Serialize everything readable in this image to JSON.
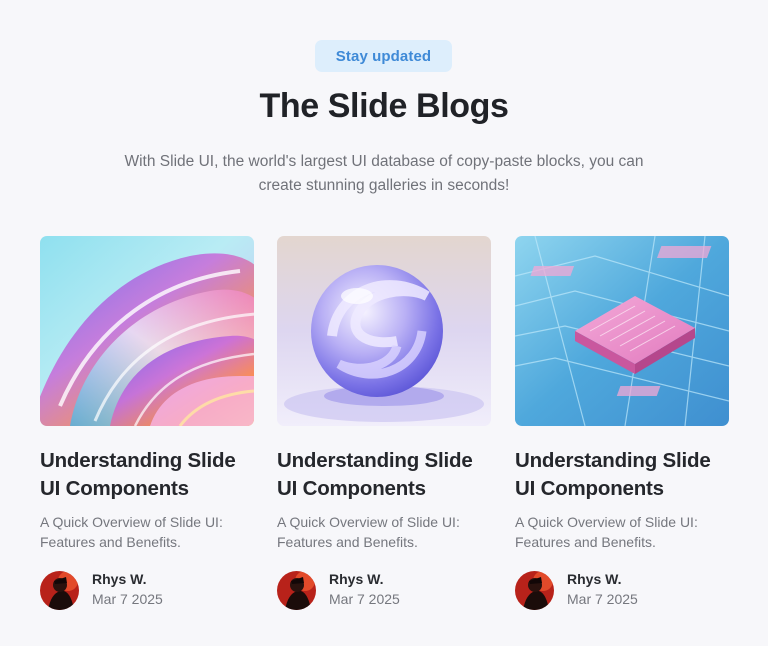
{
  "header": {
    "badge": "Stay updated",
    "title": "The Slide Blogs",
    "subtitle": "With Slide UI, the world's largest UI database of copy-paste blocks, you can create stunning galleries in seconds!"
  },
  "posts": [
    {
      "image": "abstract-glass-swirl-image",
      "title": "Understanding Slide UI Components",
      "description": "A Quick Overview of Slide UI: Features and Benefits.",
      "author": "Rhys W.",
      "date": "Mar 7 2025"
    },
    {
      "image": "glass-sphere-image",
      "title": "Understanding Slide UI Components",
      "description": "A Quick Overview of Slide UI: Features and Benefits.",
      "author": "Rhys W.",
      "date": "Mar 7 2025"
    },
    {
      "image": "circuit-chip-image",
      "title": "Understanding Slide UI Components",
      "description": "A Quick Overview of Slide UI: Features and Benefits.",
      "author": "Rhys W.",
      "date": "Mar 7 2025"
    }
  ],
  "colors": {
    "background": "#f7f7fa",
    "badge_bg": "#ddeefc",
    "badge_text": "#3f8ad7",
    "heading": "#202227",
    "muted_text": "#707279"
  }
}
